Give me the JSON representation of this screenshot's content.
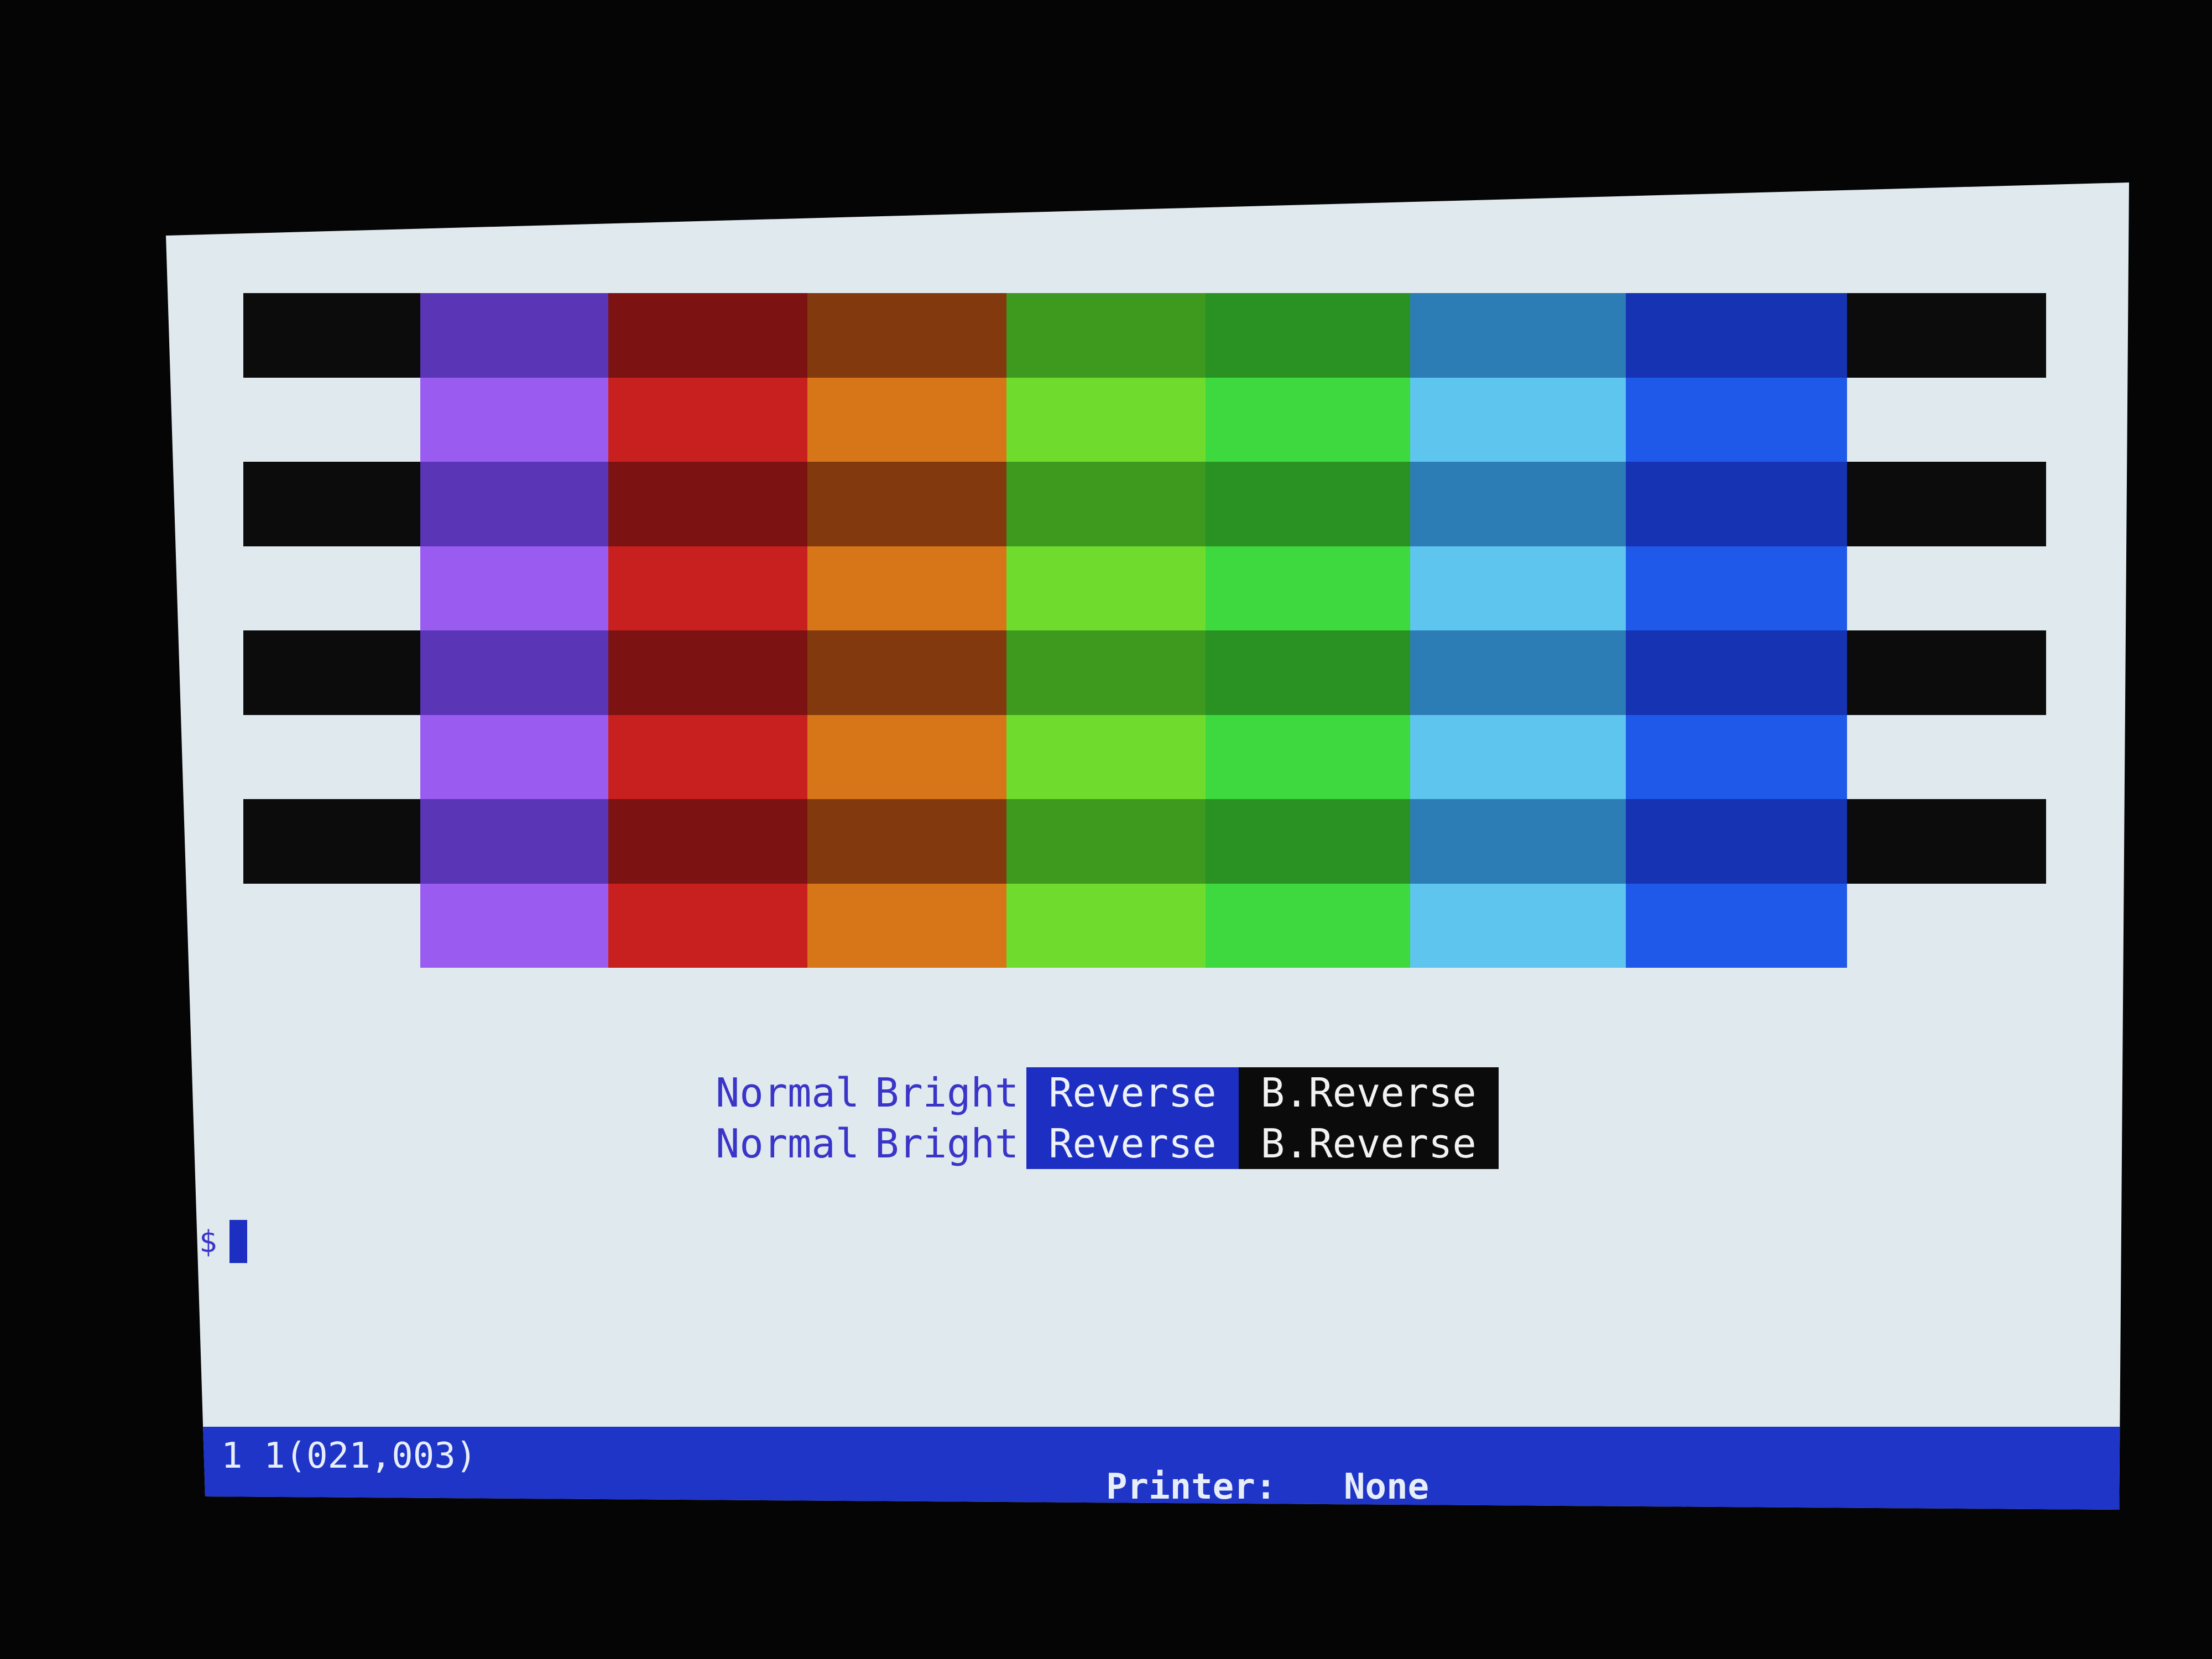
{
  "palette": {
    "columns": [
      {
        "name": "black",
        "dark": "#0c0c0c",
        "light": "#dfe9ee"
      },
      {
        "name": "violet",
        "dark": "#5a35b6",
        "light": "#9a5cf0"
      },
      {
        "name": "red",
        "dark": "#7d1212",
        "light": "#c81f1f"
      },
      {
        "name": "brown",
        "dark": "#82390e",
        "light": "#d67618"
      },
      {
        "name": "yellow-green",
        "dark": "#3d9a1f",
        "light": "#6fdb2c"
      },
      {
        "name": "green",
        "dark": "#2a9222",
        "light": "#3ed93e"
      },
      {
        "name": "cyan",
        "dark": "#2c7cb6",
        "light": "#5ec5ee"
      },
      {
        "name": "blue",
        "dark": "#1533b2",
        "light": "#1f59ea"
      },
      {
        "name": "black-right",
        "dark": "#0c0c0c",
        "light": "#dfe9ee"
      }
    ],
    "stripe_pattern": [
      "dark",
      "light",
      "dark",
      "light",
      "dark",
      "light",
      "dark",
      "light"
    ]
  },
  "attributes": {
    "rows": [
      {
        "normal": "Normal",
        "bright": "Bright",
        "reverse": "Reverse",
        "b_reverse": "B.Reverse"
      },
      {
        "normal": "Normal",
        "bright": "Bright",
        "reverse": "Reverse",
        "b_reverse": "B.Reverse"
      }
    ]
  },
  "prompt": {
    "symbol": "$"
  },
  "status_bar": {
    "position": "1 1(021,003)",
    "printer_label": "Printer:",
    "printer_value": "None"
  }
}
